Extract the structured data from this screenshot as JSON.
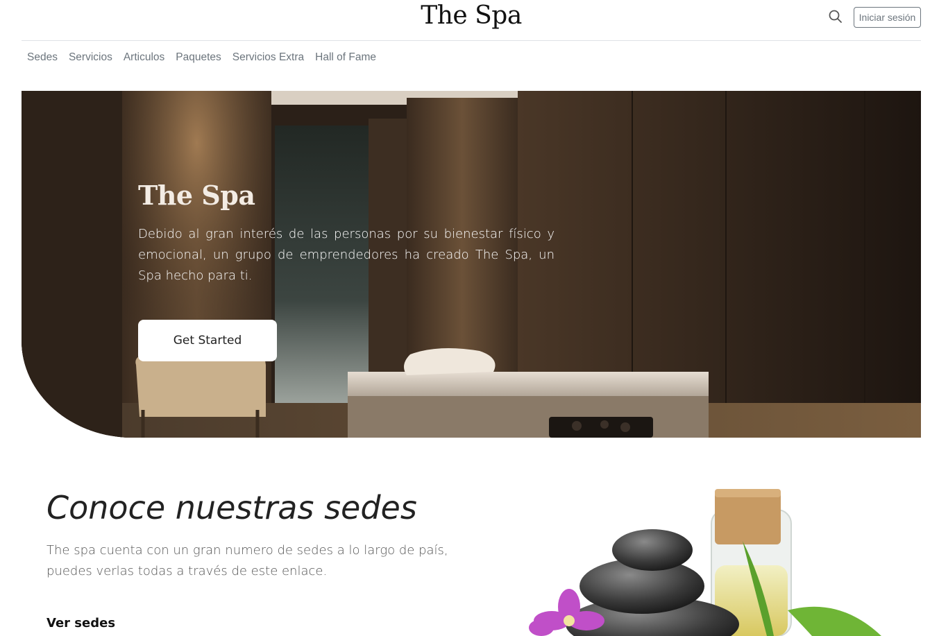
{
  "header": {
    "brand": "The Spa",
    "search_icon": "search-icon",
    "login_label": "Iniciar sesión"
  },
  "nav": {
    "items": [
      "Sedes",
      "Servicios",
      "Articulos",
      "Paquetes",
      "Servicios Extra",
      "Hall of Fame"
    ]
  },
  "hero": {
    "title": "The Spa",
    "text": "Debido al gran interés de las personas por su bienestar físico y emocional, un grupo de emprendedores ha creado The Spa, un Spa hecho para ti.",
    "cta_label": "Get Started"
  },
  "sedes": {
    "heading": "Conoce nuestras sedes",
    "text": "The spa cuenta con un gran numero de sedes a lo largo de país, puedes verlas todas a través de este enlace.",
    "link_label": "Ver sedes"
  },
  "colors": {
    "hero_bg": "#2e2218",
    "nav_text": "#6c757d",
    "orchid": "#c04fc8"
  }
}
